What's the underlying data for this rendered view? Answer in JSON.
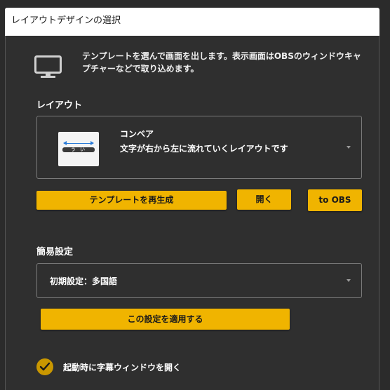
{
  "window": {
    "title": "レイアウトデザインの選択"
  },
  "intro": {
    "icon": "monitor-icon",
    "text": "テンプレートを選んで画面を出します。表示画面はOBSのウィンドウキャプチャーなどで取り込めます。"
  },
  "layout_section": {
    "label": "レイアウト",
    "selected": {
      "name": "コンベア",
      "description": "文字が右から左に流れていくレイアウトです",
      "thumbnail_text": "う い"
    }
  },
  "actions": {
    "regenerate_label": "テンプレートを再生成",
    "open_label": "開く",
    "obs_label": "to OBS"
  },
  "preset_section": {
    "label": "簡易設定",
    "selected_value": "初期設定：多国語",
    "apply_label": "この設定を適用する"
  },
  "startup_option": {
    "label": "起動時に字幕ウィンドウを開く",
    "checked": true
  },
  "colors": {
    "accent": "#f0b400",
    "background": "#2f2f2f",
    "checkbox": "#c99700"
  }
}
